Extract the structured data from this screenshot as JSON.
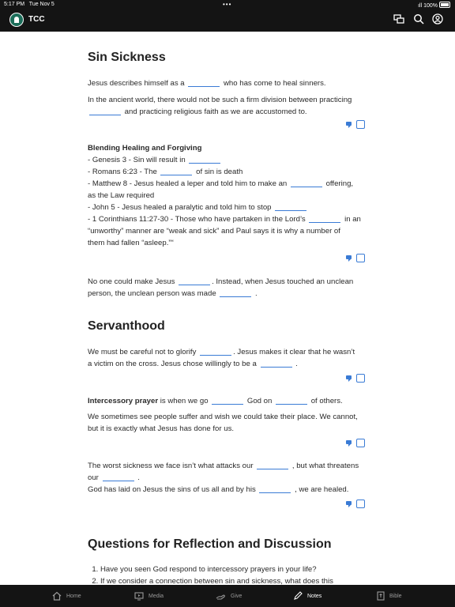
{
  "status": {
    "time": "5:17 PM",
    "date": "Tue Nov 5",
    "battery": "100%"
  },
  "header": {
    "title": "TCC"
  },
  "sections": {
    "sin": {
      "title": "Sin Sickness",
      "p1a": "Jesus describes himself as a",
      "p1b": "who has come to heal sinners.",
      "p2a": "In the ancient world, there would not be such a firm division between practicing",
      "p2b": "and practicing religious faith as we are accustomed to.",
      "heading": "Blending Healing and Forgiving",
      "l1": "- Genesis 3 - Sin will result in",
      "l2a": "- Romans 6:23 - The",
      "l2b": "of sin is death",
      "l3a": "- Matthew 8 - Jesus healed a leper and told him to make an",
      "l3b": "offering,",
      "l3c": "as the Law required",
      "l4": "- John 5 - Jesus healed a paralytic and told him to stop",
      "l5a": "- 1 Corinthians 11:27-30 - Those who have partaken in the Lord’s",
      "l5b": "in an",
      "l5c": "“unworthy” manner are “weak and sick” and Paul says it is why a number of",
      "l5d": "them had fallen “asleep.”“",
      "p3a": "No one could make Jesus",
      "p3b": ". Instead, when Jesus touched an unclean",
      "p3c": "person, the unclean person was made",
      "p3d": "."
    },
    "serv": {
      "title": "Servanthood",
      "p1a": "We must be careful not to glorify",
      "p1b": ". Jesus makes it clear that he wasn’t",
      "p1c": "a victim on the cross. Jesus chose willingly to be a",
      "p1d": ".",
      "ipa": "Intercessory prayer",
      "ipb": "is when we go",
      "ipc": "God on",
      "ipd": "of others.",
      "p2": "We sometimes see people suffer and wish we could take their place. We cannot, but it is exactly what Jesus has done for us.",
      "p3a": "The worst sickness we face isn’t what attacks our",
      "p3b": ", but what threatens",
      "p3c": "our",
      "p3d": ".",
      "p4a": "God has laid on Jesus the sins of us all and by his",
      "p4b": ", we are healed."
    },
    "questions": {
      "title": "Questions for Reflection and Discussion",
      "items": [
        "Have you seen God respond to intercessory prayers in your life?",
        "If we consider a connection between sin and sickness, what does this"
      ]
    }
  },
  "tabs": [
    {
      "label": "Home",
      "icon": "home-icon"
    },
    {
      "label": "Media",
      "icon": "media-icon"
    },
    {
      "label": "Give",
      "icon": "give-icon"
    },
    {
      "label": "Notes",
      "icon": "notes-icon",
      "active": true
    },
    {
      "label": "Bible",
      "icon": "bible-icon"
    }
  ],
  "colors": {
    "accent": "#3a7bd5",
    "bar": "#141414",
    "logo": "#1c6e5a"
  }
}
